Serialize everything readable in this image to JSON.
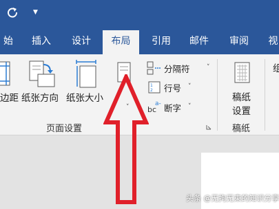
{
  "tabs": [
    {
      "label": "开始"
    },
    {
      "label": "插入"
    },
    {
      "label": "设计"
    },
    {
      "label": "布局"
    },
    {
      "label": "引用"
    },
    {
      "label": "邮件"
    },
    {
      "label": "审阅"
    },
    {
      "label": "视图"
    }
  ],
  "tabs_visible": [
    "始",
    "插入",
    "设计",
    "布局",
    "引用",
    "邮件",
    "审阅",
    "视"
  ],
  "page_setup": {
    "margins": "边距",
    "orientation": "纸张方向",
    "size": "纸张大小",
    "breaks": "分隔符",
    "line_numbers": "行号",
    "hyphenation": "断字",
    "group_label": "页面设置"
  },
  "manuscript": {
    "button_line1": "稿纸",
    "button_line2": "设置",
    "group_label": "稿纸"
  },
  "partial_right": "组",
  "watermark": "头条 @无拘无束的知识分享",
  "colors": {
    "ribbon_blue": "#2b579a",
    "arrow_red": "#e0202a"
  }
}
